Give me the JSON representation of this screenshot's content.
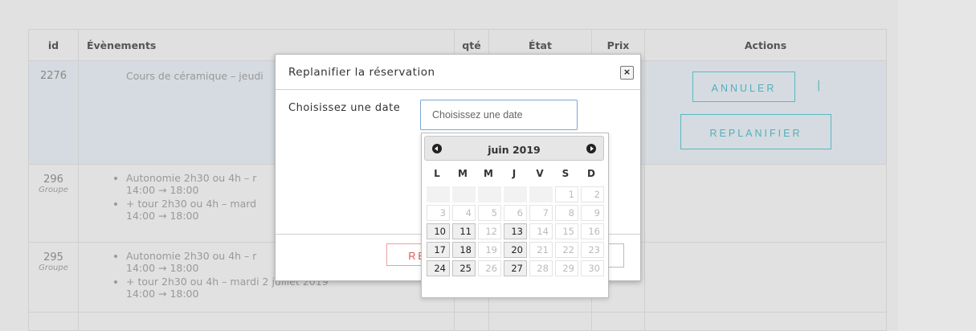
{
  "table": {
    "headers": {
      "id": "id",
      "events": "Évènements",
      "qte": "qté",
      "etat": "État",
      "prix": "Prix",
      "actions": "Actions"
    },
    "rows": [
      {
        "id": "2276",
        "event": "Cours de céramique – jeudi"
      },
      {
        "id": "296",
        "group": "Groupe",
        "items": [
          {
            "text": "Autonomie 2h30 ou 4h – r",
            "time": "14:00 → 18:00"
          },
          {
            "text": "+ tour 2h30 ou 4h – mard",
            "time": "14:00 → 18:00"
          }
        ]
      },
      {
        "id": "295",
        "group": "Groupe",
        "items": [
          {
            "text": "Autonomie 2h30 ou 4h – r",
            "time": "14:00 → 18:00"
          },
          {
            "text": "+ tour 2h30 ou 4h – mardi 2 juillet 2019",
            "time": "14:00 → 18:00"
          }
        ]
      }
    ],
    "actions": {
      "annuler": "ANNULER",
      "separator": "|",
      "replanifier": "REPLANIFIER"
    }
  },
  "modal": {
    "title": "Replanifier la réservation",
    "close": "×",
    "date_label": "Choisissez une date",
    "date_placeholder": "Choisissez une date",
    "button_re": "RE"
  },
  "datepicker": {
    "month": "juin 2019",
    "weekdays": [
      "L",
      "M",
      "M",
      "J",
      "V",
      "S",
      "D"
    ],
    "weeks": [
      [
        {
          "d": "",
          "s": "empty"
        },
        {
          "d": "",
          "s": "empty"
        },
        {
          "d": "",
          "s": "empty"
        },
        {
          "d": "",
          "s": "empty"
        },
        {
          "d": "",
          "s": "empty"
        },
        {
          "d": "1",
          "s": "dis"
        },
        {
          "d": "2",
          "s": "dis"
        }
      ],
      [
        {
          "d": "3",
          "s": "dis"
        },
        {
          "d": "4",
          "s": "dis"
        },
        {
          "d": "5",
          "s": "dis"
        },
        {
          "d": "6",
          "s": "dis"
        },
        {
          "d": "7",
          "s": "dis"
        },
        {
          "d": "8",
          "s": "dis"
        },
        {
          "d": "9",
          "s": "dis"
        }
      ],
      [
        {
          "d": "10",
          "s": "on"
        },
        {
          "d": "11",
          "s": "on"
        },
        {
          "d": "12",
          "s": "dis"
        },
        {
          "d": "13",
          "s": "on"
        },
        {
          "d": "14",
          "s": "dis"
        },
        {
          "d": "15",
          "s": "dis"
        },
        {
          "d": "16",
          "s": "dis"
        }
      ],
      [
        {
          "d": "17",
          "s": "on"
        },
        {
          "d": "18",
          "s": "on"
        },
        {
          "d": "19",
          "s": "dis"
        },
        {
          "d": "20",
          "s": "on"
        },
        {
          "d": "21",
          "s": "dis"
        },
        {
          "d": "22",
          "s": "dis"
        },
        {
          "d": "23",
          "s": "dis"
        }
      ],
      [
        {
          "d": "24",
          "s": "on"
        },
        {
          "d": "25",
          "s": "on"
        },
        {
          "d": "26",
          "s": "dis"
        },
        {
          "d": "27",
          "s": "on"
        },
        {
          "d": "28",
          "s": "dis"
        },
        {
          "d": "29",
          "s": "dis"
        },
        {
          "d": "30",
          "s": "dis"
        }
      ]
    ]
  }
}
